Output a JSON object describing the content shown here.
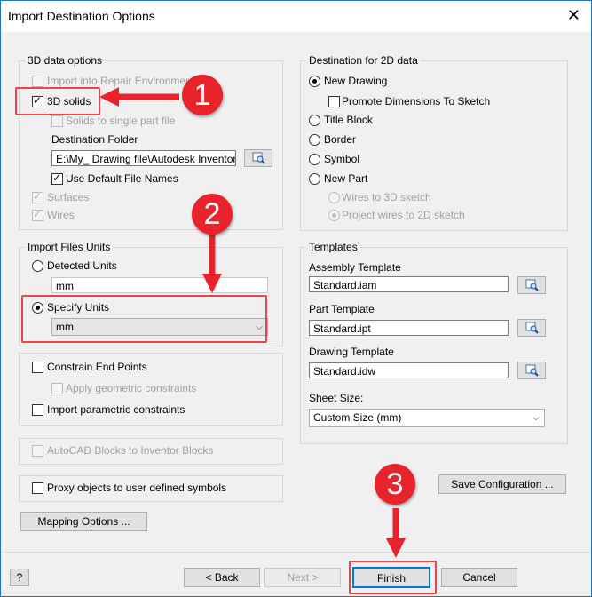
{
  "window": {
    "title": "Import Destination Options",
    "close_glyph": "✕"
  },
  "data3d": {
    "legend": "3D data options",
    "import_repair": "Import into Repair Environment",
    "solids_3d": "3D solids",
    "solids_single": "Solids to single part file",
    "dest_folder_label": "Destination Folder",
    "dest_folder_value": "E:\\My_ Drawing file\\Autodesk Inventor",
    "use_default_names": "Use Default File Names",
    "surfaces": "Surfaces",
    "wires": "Wires"
  },
  "units": {
    "legend": "Import Files Units",
    "detected": "Detected Units",
    "detected_value": "mm",
    "specify": "Specify Units",
    "specify_value": "mm"
  },
  "constraints": {
    "end_points": "Constrain End Points",
    "apply_geo": "Apply geometric constraints",
    "parametric": "Import parametric constraints"
  },
  "autocad_blocks": "AutoCAD Blocks to Inventor Blocks",
  "proxy": "Proxy objects to user defined symbols",
  "mapping_button": "Mapping Options ...",
  "dest2d": {
    "legend": "Destination for 2D data",
    "new_drawing": "New Drawing",
    "promote_dims": "Promote Dimensions To Sketch",
    "title_block": "Title Block",
    "border": "Border",
    "symbol": "Symbol",
    "new_part": "New Part",
    "wires_3d": "Wires to 3D sketch",
    "project_wires": "Project wires to 2D sketch"
  },
  "templates": {
    "legend": "Templates",
    "assembly_label": "Assembly Template",
    "assembly_value": "Standard.iam",
    "part_label": "Part Template",
    "part_value": "Standard.ipt",
    "drawing_label": "Drawing Template",
    "drawing_value": "Standard.idw",
    "sheet_label": "Sheet Size:",
    "sheet_value": "Custom Size (mm)"
  },
  "save_config": "Save Configuration ...",
  "footer": {
    "help": "?",
    "back": "< Back",
    "next": "Next >",
    "finish": "Finish",
    "cancel": "Cancel"
  },
  "callouts": [
    "1",
    "2",
    "3"
  ],
  "icons": {
    "browse": "folder-browse-icon"
  },
  "colors": {
    "annotation_red": "#e8232b",
    "title_border": "#1e73c7"
  }
}
